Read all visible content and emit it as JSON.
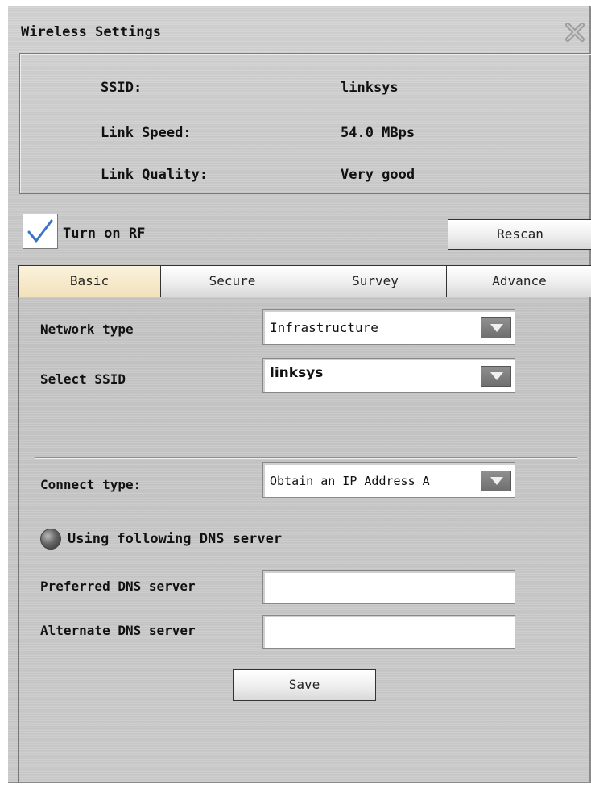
{
  "window": {
    "title": "Wireless Settings"
  },
  "info": {
    "ssid_label": "SSID:",
    "ssid_value": "linksys",
    "link_speed_label": "Link Speed:",
    "link_speed_value": "54.0 MBps",
    "link_quality_label": "Link Quality:",
    "link_quality_value": "Very good"
  },
  "rf": {
    "label": "Turn on RF",
    "checked": true
  },
  "rescan_label": "Rescan",
  "tabs": [
    {
      "label": "Basic",
      "active": true
    },
    {
      "label": "Secure",
      "active": false
    },
    {
      "label": "Survey",
      "active": false
    },
    {
      "label": "Advance",
      "active": false
    }
  ],
  "basic": {
    "network_type_label": "Network type",
    "network_type_value": "Infrastructure",
    "select_ssid_label": "Select SSID",
    "select_ssid_value": "linksys",
    "connect_type_label": "Connect type:",
    "connect_type_value": "Obtain an IP Address A",
    "dns_radio_label": "Using following DNS server",
    "preferred_dns_label": "Preferred DNS server",
    "preferred_dns_value": "",
    "alternate_dns_label": "Alternate DNS server",
    "alternate_dns_value": "",
    "save_label": "Save"
  },
  "colors": {
    "active_tab": "#f2e2bc",
    "panel_bg": "#c8c8c8"
  }
}
